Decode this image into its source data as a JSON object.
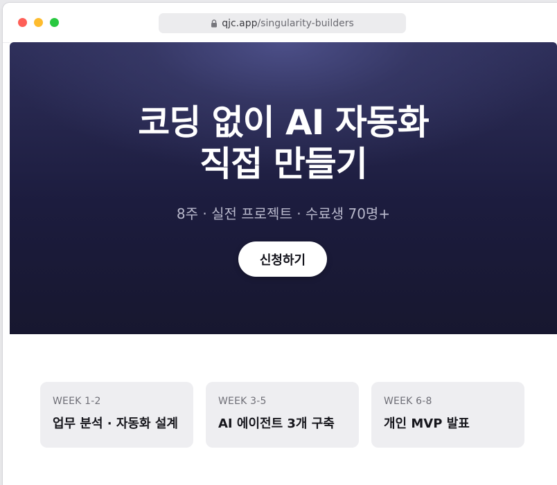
{
  "browser": {
    "url_domain": "qjc.app",
    "url_path": "/singularity-builders",
    "icons": [
      "lock-icon"
    ],
    "traffic_lights": [
      "#fe5f57",
      "#febc2e",
      "#28c840"
    ]
  },
  "hero": {
    "title_line1": "코딩 없이 AI 자동화",
    "title_line2": "직접 만들기",
    "subtitle": "8주 · 실전 프로젝트 · 수료생 70명+",
    "cta_label": "신청하기"
  },
  "curriculum": [
    {
      "week": "WEEK 1-2",
      "title": "업무 분석 · 자동화 설계"
    },
    {
      "week": "WEEK 3-5",
      "title": "AI 에이전트 3개 구축"
    },
    {
      "week": "WEEK 6-8",
      "title": "개인 MVP 발표"
    }
  ],
  "colors": {
    "hero_bg": "#1c1c3e",
    "card_bg": "#eeeef1",
    "cta_bg": "#ffffff"
  }
}
